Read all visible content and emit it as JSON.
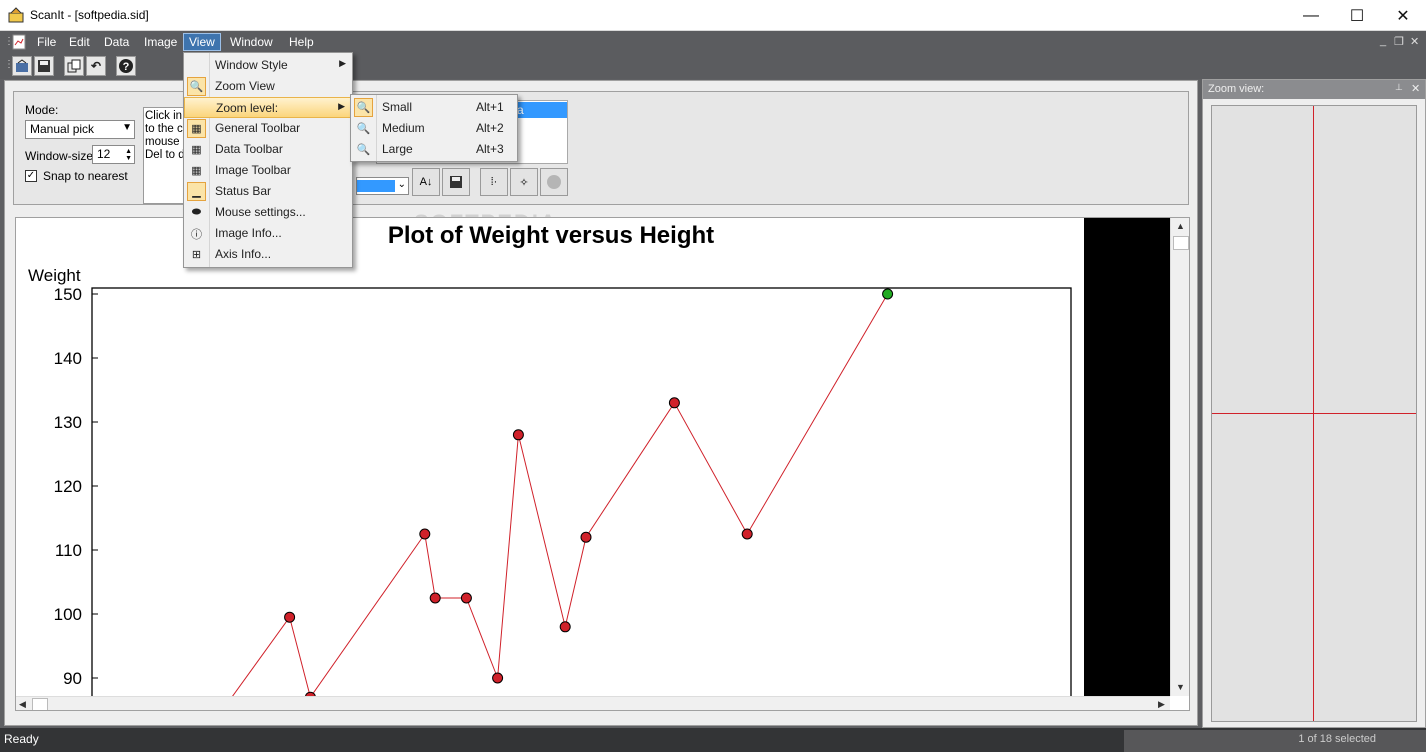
{
  "window": {
    "title": "ScanIt - [softpedia.sid]",
    "minimize_glyph": "—",
    "maximize_glyph": "☐",
    "close_glyph": "✕"
  },
  "menubar": {
    "items": [
      "File",
      "Edit",
      "Data",
      "Image",
      "View",
      "Window",
      "Help"
    ],
    "active": "View",
    "mdi_controls": [
      "_",
      "❐",
      "✕"
    ]
  },
  "toolbar": {
    "buttons": [
      "open-icon",
      "save-icon",
      "copy-icon",
      "undo-icon",
      "help-icon"
    ]
  },
  "control_panel": {
    "mode_label": "Mode:",
    "mode_value": "Manual pick",
    "window_size_label": "Window-size:",
    "window_size_value": "12",
    "snap_label": "Snap to nearest",
    "snap_checked": true,
    "instructions_lines": [
      "Click in t",
      "to the co",
      "mouse b",
      "Del to de"
    ],
    "list_selected": "a"
  },
  "view_menu": {
    "items": [
      {
        "label": "Window Style",
        "submenu": true,
        "icon": "none"
      },
      {
        "label": "Zoom View",
        "submenu": false,
        "icon": "zoom-view-icon",
        "checked": true
      },
      {
        "label": "Zoom level:",
        "submenu": true,
        "icon": "none",
        "highlighted": true
      },
      {
        "label": "General Toolbar",
        "submenu": false,
        "icon": "general-toolbar-icon",
        "checked": true
      },
      {
        "label": "Data Toolbar",
        "submenu": false,
        "icon": "data-toolbar-icon"
      },
      {
        "label": "Image Toolbar",
        "submenu": false,
        "icon": "image-toolbar-icon"
      },
      {
        "label": "Status Bar",
        "submenu": false,
        "icon": "status-bar-icon",
        "checked": true
      },
      {
        "label": "Mouse settings...",
        "submenu": false,
        "icon": "mouse-icon"
      },
      {
        "label": "Image Info...",
        "submenu": false,
        "icon": "image-info-icon"
      },
      {
        "label": "Axis Info...",
        "submenu": false,
        "icon": "axis-info-icon"
      }
    ]
  },
  "zoom_level_menu": {
    "items": [
      {
        "label": "Small",
        "shortcut": "Alt+1",
        "icon": "zoom-small-icon",
        "checked": true
      },
      {
        "label": "Medium",
        "shortcut": "Alt+2",
        "icon": "zoom-medium-icon"
      },
      {
        "label": "Large",
        "shortcut": "Alt+3",
        "icon": "zoom-large-icon"
      }
    ]
  },
  "watermark": "SOFTPEDIA",
  "chart_data": {
    "type": "line",
    "title": "Plot of Weight versus Height",
    "ylabel": "Weight",
    "xlabel": "",
    "ylim": [
      90,
      150
    ],
    "yticks": [
      150,
      140,
      130,
      120,
      110,
      100,
      90
    ],
    "grid": false,
    "series": [
      {
        "x": [
          0.26,
          0.38,
          0.42,
          0.64,
          0.66,
          0.72,
          0.78,
          0.82,
          0.91,
          0.95,
          1.12,
          1.26,
          1.53
        ],
        "values": [
          86,
          99.5,
          87,
          112.5,
          102.5,
          102.5,
          90,
          128,
          98,
          112,
          133,
          112.5,
          150
        ],
        "color": "#d0212a"
      }
    ],
    "selected_point_color": "#22aa22"
  },
  "zoom_pane": {
    "title": "Zoom view:",
    "pin_glyph": "📌",
    "close_glyph": "✕"
  },
  "statusbar": {
    "left": "Ready",
    "right": "1 of 18 selected"
  }
}
